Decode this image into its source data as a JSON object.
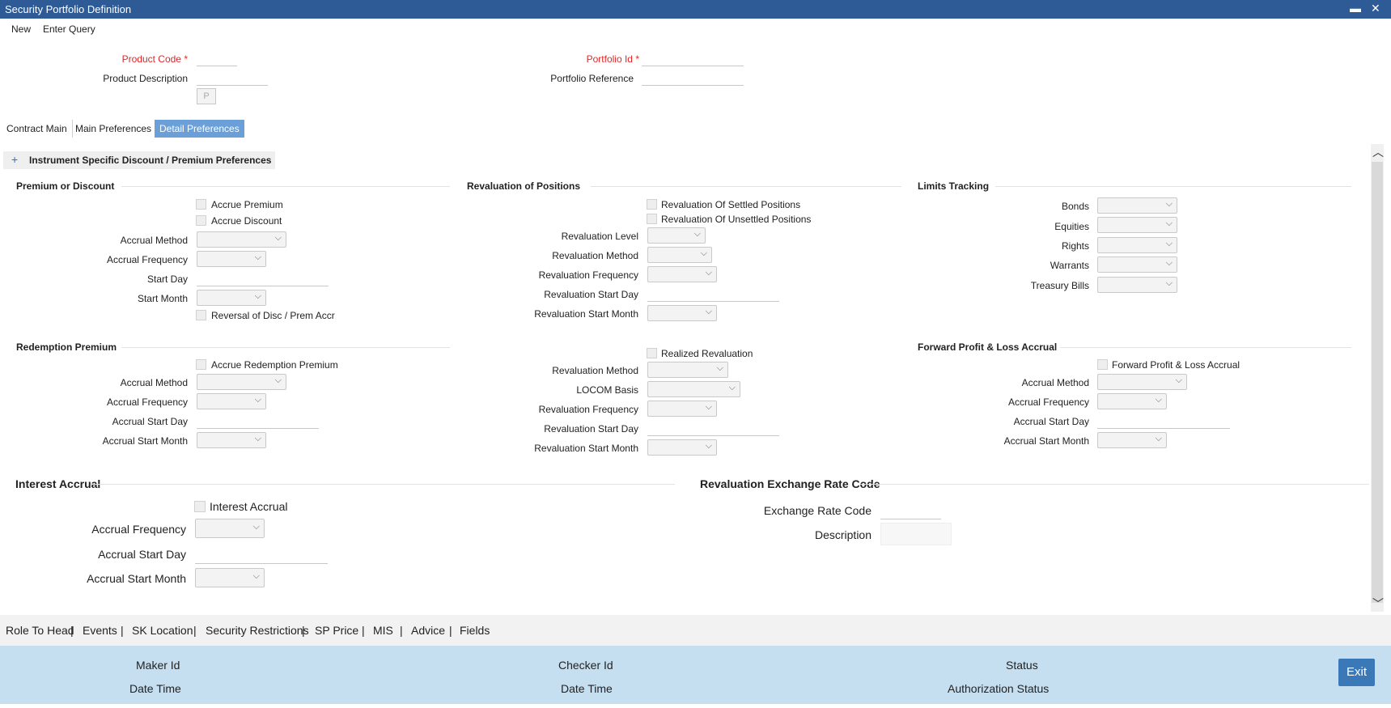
{
  "window": {
    "title": "Security Portfolio Definition",
    "minimize": "▬",
    "close": "✕"
  },
  "toolbar": {
    "new": "New",
    "enter_query": "Enter Query"
  },
  "header": {
    "product_code": "Product Code",
    "product_description": "Product Description",
    "p_button": "P",
    "portfolio_id": "Portfolio Id",
    "portfolio_reference": "Portfolio Reference",
    "required_mark": "*"
  },
  "tabs": [
    "Contract Main",
    "Main Preferences",
    "Detail Preferences"
  ],
  "subheader": {
    "plus": "+",
    "title": "Instrument Specific Discount / Premium Preferences"
  },
  "premium_or_discount": {
    "title": "Premium or Discount",
    "accrue_premium": "Accrue Premium",
    "accrue_discount": "Accrue Discount",
    "accrual_method": "Accrual Method",
    "accrual_frequency": "Accrual Frequency",
    "start_day": "Start Day",
    "start_month": "Start Month",
    "reversal": "Reversal of Disc / Prem Accr"
  },
  "revaluation_positions": {
    "title": "Revaluation of Positions",
    "settled": "Revaluation Of Settled Positions",
    "unsettled": "Revaluation Of Unsettled Positions",
    "level": "Revaluation Level",
    "method": "Revaluation Method",
    "frequency": "Revaluation Frequency",
    "start_day": "Revaluation Start Day",
    "start_month": "Revaluation Start Month"
  },
  "limits_tracking": {
    "title": "Limits Tracking",
    "bonds": "Bonds",
    "equities": "Equities",
    "rights": "Rights",
    "warrants": "Warrants",
    "treasury_bills": "Treasury Bills"
  },
  "redemption_premium": {
    "title": "Redemption Premium",
    "accrue": "Accrue Redemption Premium",
    "accrual_method": "Accrual Method",
    "accrual_frequency": "Accrual Frequency",
    "accrual_start_day": "Accrual Start Day",
    "accrual_start_month": "Accrual Start Month"
  },
  "realized_revaluation": {
    "realized": "Realized Revaluation",
    "method": "Revaluation Method",
    "locom": "LOCOM Basis",
    "frequency": "Revaluation Frequency",
    "start_day": "Revaluation Start Day",
    "start_month": "Revaluation Start Month"
  },
  "forward_pl": {
    "title": "Forward Profit & Loss Accrual",
    "checkbox": "Forward Profit & Loss Accrual",
    "accrual_method": "Accrual Method",
    "accrual_frequency": "Accrual Frequency",
    "accrual_start_day": "Accrual Start Day",
    "accrual_start_month": "Accrual Start Month"
  },
  "interest_accrual": {
    "title": "Interest Accrual",
    "checkbox": "Interest Accrual",
    "accrual_frequency": "Accrual Frequency",
    "accrual_start_day": "Accrual Start Day",
    "accrual_start_month": "Accrual Start Month"
  },
  "reval_exchange": {
    "title": "Revaluation Exchange Rate Code",
    "code": "Exchange Rate Code",
    "description": "Description"
  },
  "bottom_links": [
    "Role To Head",
    "Events",
    "SK Location",
    "Security Restrictions",
    "SP Price",
    "MIS",
    "Advice",
    "Fields"
  ],
  "bottom_sep": "|",
  "footer": {
    "maker_id": "Maker Id",
    "date_time_1": "Date Time",
    "checker_id": "Checker Id",
    "date_time_2": "Date Time",
    "status": "Status",
    "authorization_status": "Authorization Status",
    "exit": "Exit"
  },
  "icons": {
    "dropdown": "chevron-down-icon",
    "scroll_up": "chevron-up-icon",
    "scroll_down": "chevron-down-icon"
  },
  "colors": {
    "titlebar": "#2e5b96",
    "active_tab": "#6b9fd8",
    "required": "#e32626",
    "footer": "#c6dff0",
    "exit_button": "#3b78b7"
  }
}
